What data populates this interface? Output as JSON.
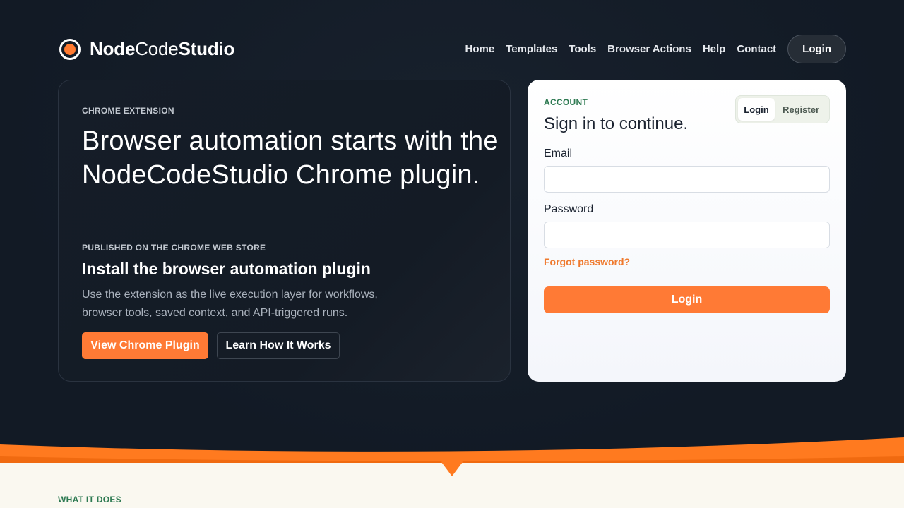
{
  "brand": {
    "name_bold1": "Node",
    "name_regular": "Code",
    "name_bold2": "Studio",
    "accent": "#ff7a35"
  },
  "nav": {
    "items": [
      "Home",
      "Templates",
      "Tools",
      "Browser Actions",
      "Help",
      "Contact"
    ],
    "login_label": "Login"
  },
  "hero": {
    "eyebrow": "CHROME EXTENSION",
    "title": "Browser automation starts with the NodeCodeStudio Chrome plugin.",
    "eyebrow2": "PUBLISHED ON THE CHROME WEB STORE",
    "subtitle": "Install the browser automation plugin",
    "description": "Use the extension as the live execution layer for workflows, browser tools, saved context, and API-triggered runs.",
    "primary_button": "View Chrome Plugin",
    "secondary_button": "Learn How It Works"
  },
  "account": {
    "eyebrow": "ACCOUNT",
    "title": "Sign in to continue.",
    "toggle_login": "Login",
    "toggle_register": "Register",
    "email_label": "Email",
    "email_value": "",
    "password_label": "Password",
    "password_value": "",
    "forgot_label": "Forgot password?",
    "submit_label": "Login"
  },
  "section": {
    "eyebrow": "WHAT IT DOES"
  }
}
